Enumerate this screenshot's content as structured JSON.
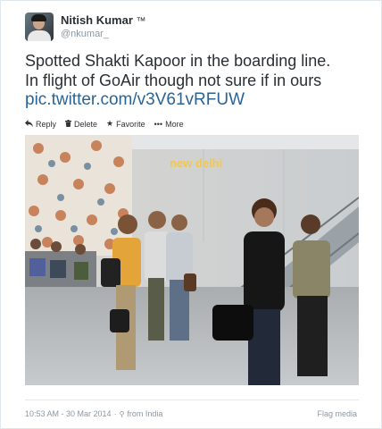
{
  "user": {
    "name": "Nitish Kumar",
    "name_suffix": "™",
    "handle": "@nkumar_"
  },
  "tweet": {
    "text_line1": "Spotted Shakti Kapoor in the boarding line.",
    "text_line2": "In flight of GoAir though not sure if in ours",
    "link": "pic.twitter.com/v3V61vRFUW"
  },
  "actions": [
    {
      "icon": "reply-icon",
      "label": "Reply"
    },
    {
      "icon": "trash-icon",
      "label": "Delete"
    },
    {
      "icon": "star-icon",
      "label": "Favorite"
    },
    {
      "icon": "more-icon",
      "label": "More"
    }
  ],
  "photo": {
    "sign_text": "new delhi"
  },
  "footer": {
    "timestamp": "10:53 AM - 30 Mar 2014",
    "location_separator": "·",
    "location": "from India",
    "flag_label": "Flag media"
  },
  "colors": {
    "link": "#2a6496",
    "muted": "#8899a6",
    "text": "#292f33"
  }
}
